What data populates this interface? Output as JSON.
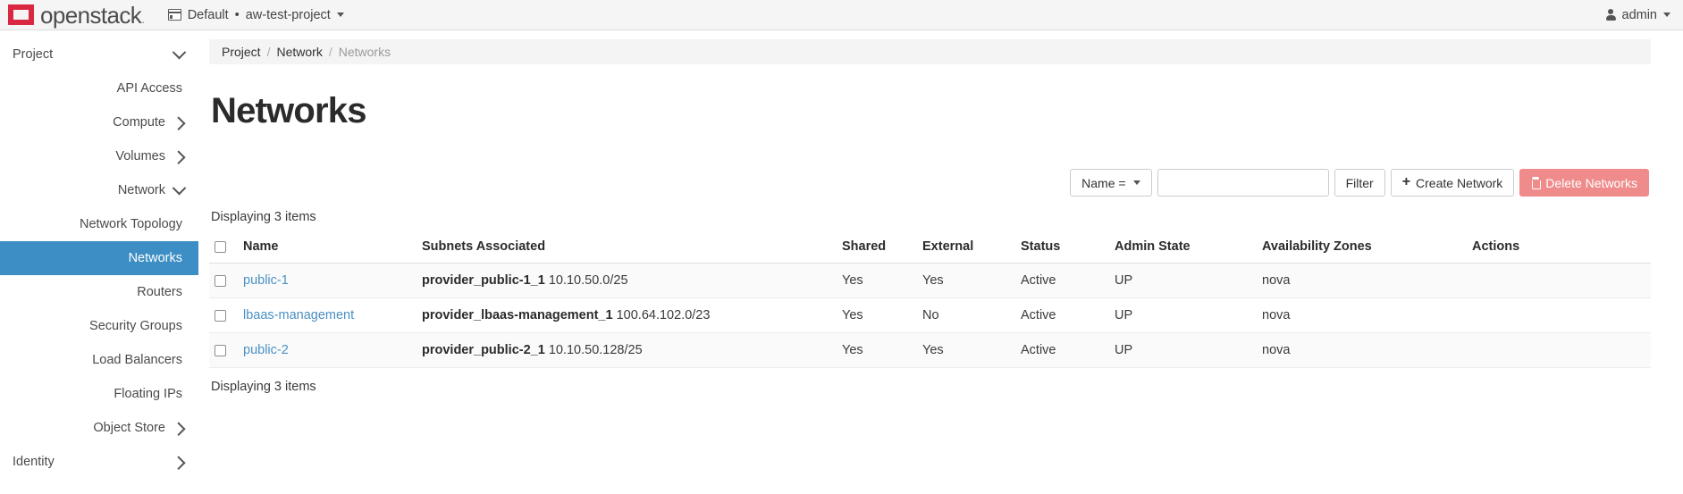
{
  "navbar": {
    "brand_text": "openstack",
    "brand_dot": ".",
    "domain_label": "Default",
    "separator": "•",
    "project_label": "aw-test-project",
    "user_label": "admin"
  },
  "sidebar": {
    "items": [
      {
        "label": "Project",
        "level": "group",
        "chevron": "down",
        "active": false
      },
      {
        "label": "API Access",
        "level": "sub",
        "chevron": "none",
        "active": false
      },
      {
        "label": "Compute",
        "level": "mid",
        "chevron": "right",
        "active": false
      },
      {
        "label": "Volumes",
        "level": "mid",
        "chevron": "right",
        "active": false
      },
      {
        "label": "Network",
        "level": "mid",
        "chevron": "down",
        "active": false
      },
      {
        "label": "Network Topology",
        "level": "sub",
        "chevron": "none",
        "active": false
      },
      {
        "label": "Networks",
        "level": "sub",
        "chevron": "none",
        "active": true
      },
      {
        "label": "Routers",
        "level": "sub",
        "chevron": "none",
        "active": false
      },
      {
        "label": "Security Groups",
        "level": "sub",
        "chevron": "none",
        "active": false
      },
      {
        "label": "Load Balancers",
        "level": "sub",
        "chevron": "none",
        "active": false
      },
      {
        "label": "Floating IPs",
        "level": "sub",
        "chevron": "none",
        "active": false
      },
      {
        "label": "Object Store",
        "level": "mid",
        "chevron": "right",
        "active": false
      },
      {
        "label": "Identity",
        "level": "group",
        "chevron": "right",
        "active": false
      }
    ]
  },
  "breadcrumb": {
    "item1": "Project",
    "sep1": "/",
    "item2": "Network",
    "sep2": "/",
    "current": "Networks"
  },
  "page": {
    "title": "Networks",
    "items_count_top": "Displaying 3 items",
    "items_count_bottom": "Displaying 3 items"
  },
  "toolbar": {
    "filter_key_label": "Name =",
    "filter_input_value": "",
    "filter_input_placeholder": "",
    "filter_button": "Filter",
    "create_button": "Create Network",
    "create_icon": "plus-icon",
    "delete_button": "Delete Networks",
    "delete_icon": "trash-icon",
    "danger_color": "#ef8b8b",
    "accent_color": "#3d8ec4"
  },
  "table": {
    "columns": [
      "Name",
      "Subnets Associated",
      "Shared",
      "External",
      "Status",
      "Admin State",
      "Availability Zones",
      "Actions"
    ],
    "rows": [
      {
        "name": "public-1",
        "subnet_name": "provider_public-1_1",
        "subnet_cidr": "10.10.50.0/25",
        "shared": "Yes",
        "external": "Yes",
        "status": "Active",
        "admin_state": "UP",
        "availability_zones": "nova",
        "actions": ""
      },
      {
        "name": "lbaas-management",
        "subnet_name": "provider_lbaas-management_1",
        "subnet_cidr": "100.64.102.0/23",
        "shared": "Yes",
        "external": "No",
        "status": "Active",
        "admin_state": "UP",
        "availability_zones": "nova",
        "actions": ""
      },
      {
        "name": "public-2",
        "subnet_name": "provider_public-2_1",
        "subnet_cidr": "10.10.50.128/25",
        "shared": "Yes",
        "external": "Yes",
        "status": "Active",
        "admin_state": "UP",
        "availability_zones": "nova",
        "actions": ""
      }
    ]
  }
}
